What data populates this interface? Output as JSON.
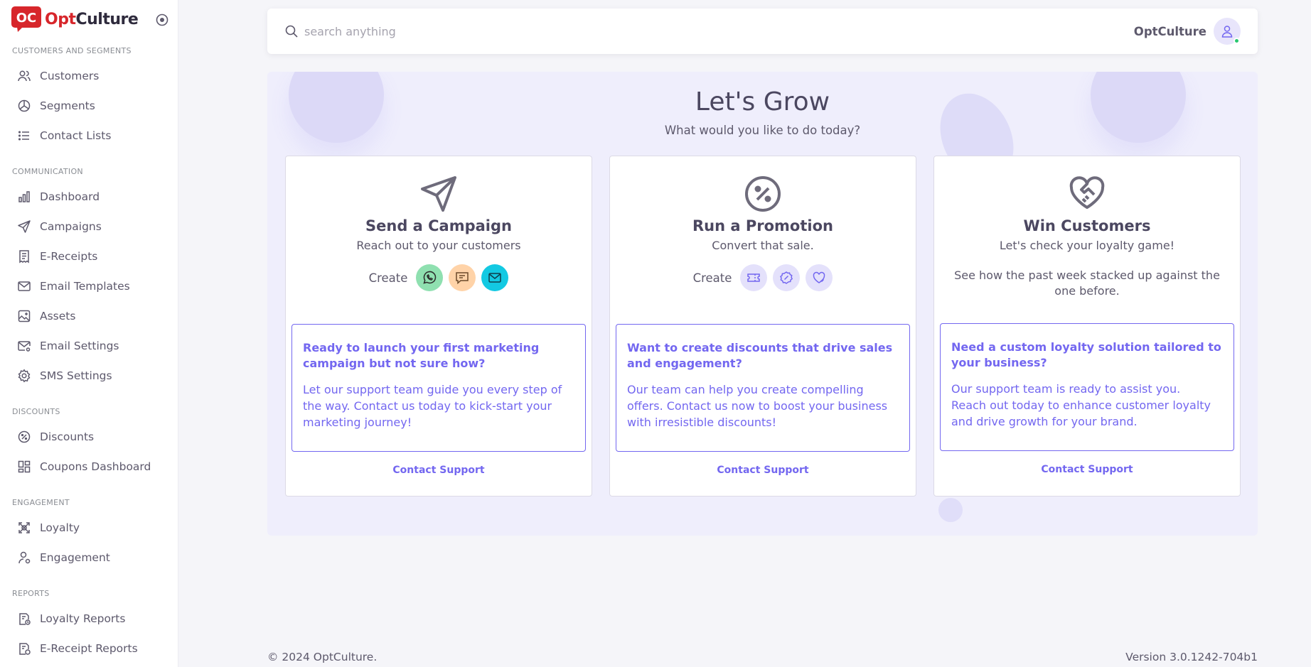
{
  "brand": {
    "name_part1": "Opt",
    "name_part2": "Culture",
    "logo_text": "OC"
  },
  "sidebar": {
    "sections": [
      {
        "header": "CUSTOMERS AND SEGMENTS",
        "items": [
          {
            "label": "Customers",
            "icon": "users-icon"
          },
          {
            "label": "Segments",
            "icon": "pie-chart-icon"
          },
          {
            "label": "Contact Lists",
            "icon": "list-icon"
          }
        ]
      },
      {
        "header": "COMMUNICATION",
        "items": [
          {
            "label": "Dashboard",
            "icon": "bar-chart-icon"
          },
          {
            "label": "Campaigns",
            "icon": "send-icon"
          },
          {
            "label": "E-Receipts",
            "icon": "receipt-icon"
          },
          {
            "label": "Email Templates",
            "icon": "mail-icon"
          },
          {
            "label": "Assets",
            "icon": "image-icon"
          },
          {
            "label": "Email Settings",
            "icon": "mail-settings-icon"
          },
          {
            "label": "SMS Settings",
            "icon": "gear-icon"
          }
        ]
      },
      {
        "header": "DISCOUNTS",
        "items": [
          {
            "label": "Discounts",
            "icon": "discount-icon"
          },
          {
            "label": "Coupons Dashboard",
            "icon": "dashboard-icon"
          }
        ]
      },
      {
        "header": "ENGAGEMENT",
        "items": [
          {
            "label": "Loyalty",
            "icon": "loyalty-icon"
          },
          {
            "label": "Engagement",
            "icon": "user-engagement-icon"
          }
        ]
      },
      {
        "header": "REPORTS",
        "items": [
          {
            "label": "Loyalty Reports",
            "icon": "report-icon"
          },
          {
            "label": "E-Receipt Reports",
            "icon": "report-icon"
          }
        ]
      }
    ]
  },
  "topbar": {
    "search_placeholder": "search anything",
    "user_name": "OptCulture"
  },
  "panel": {
    "title": "Let's Grow",
    "subtitle": "What would you like to do today?",
    "cards": [
      {
        "title": "Send a Campaign",
        "desc": "Reach out to your customers",
        "create_label": "Create",
        "support_q": "Ready to launch your first marketing campaign but not sure how?",
        "support_t": "Let our support team guide you every step of the way. Contact us today to kick-start your marketing journey!",
        "contact": "Contact Support"
      },
      {
        "title": "Run a Promotion",
        "desc": "Convert that sale.",
        "create_label": "Create",
        "support_q": "Want to create discounts that drive sales and engagement?",
        "support_t": "Our team can help you create compelling offers. Contact us now to boost your business with irresistible discounts!",
        "contact": "Contact Support"
      },
      {
        "title": "Win Customers",
        "desc": "Let's check your loyalty game!",
        "note": "See how the past week stacked up against the one before.",
        "support_q": "Need a custom loyalty solution tailored to your business?",
        "support_t1": "Our support team is ready to assist you.",
        "support_t2": "Reach out today to enhance customer loyalty and drive growth for your brand.",
        "contact": "Contact Support"
      }
    ]
  },
  "colors": {
    "accent": "#7367f0",
    "brand_red": "#d7262b",
    "whatsapp": "#8fe0b0",
    "sms": "#ffd3a8",
    "email": "#13c9e2",
    "panel_bg": "#efeefc"
  },
  "footer": {
    "copyright": "© 2024 OptCulture.",
    "version": "Version 3.0.1242-704b1"
  }
}
